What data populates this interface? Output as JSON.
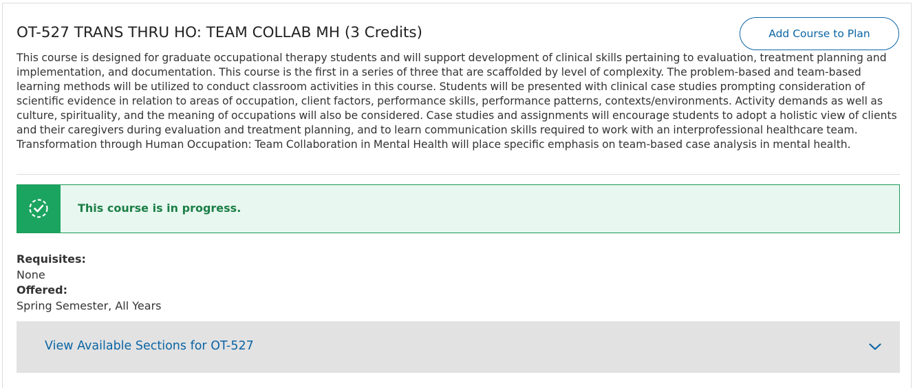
{
  "course": {
    "title": "OT-527 TRANS THRU HO: TEAM COLLAB MH (3 Credits)",
    "description": "This course is designed for graduate occupational therapy students and will support development of clinical skills pertaining to evaluation, treatment planning and implementation, and documentation. This course is the first in a series of three that are scaffolded by level of complexity. The problem-based and team-based learning methods will be utilized to conduct classroom activities in this course. Students will be presented with clinical case studies prompting consideration of scientific evidence in relation to areas of occupation, client factors, performance skills, performance patterns, contexts/environments. Activity demands as well as culture, spirituality, and the meaning of occupations will also be considered. Case studies and assignments will encourage students to adopt a holistic view of clients and their caregivers during evaluation and treatment planning, and to learn communication skills required to work with an interprofessional healthcare team. Transformation through Human Occupation: Team Collaboration in Mental Health will place specific emphasis on team-based case analysis in mental health."
  },
  "actions": {
    "add_course_label": "Add Course to Plan"
  },
  "status": {
    "message": "This course is in progress.",
    "icon": "progress-check-icon",
    "color": "#1ba45f"
  },
  "details": {
    "requisites_label": "Requisites:",
    "requisites_value": "None",
    "offered_label": "Offered:",
    "offered_value": "Spring Semester, All Years"
  },
  "sections": {
    "label": "View Available Sections for OT-527",
    "icon": "chevron-down-icon"
  },
  "colors": {
    "accent": "#0a64a4",
    "success": "#1ba45f",
    "success_bg": "#e8f7f0",
    "panel_bg": "#e2e2e2"
  }
}
